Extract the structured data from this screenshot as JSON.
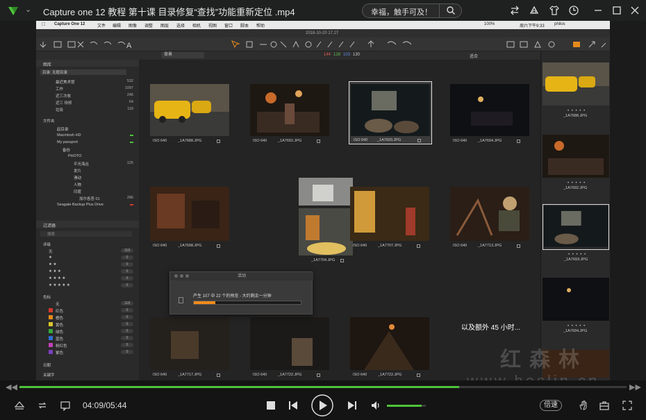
{
  "player": {
    "title": "Capture one 12 教程 第十课 目录修复“查找”功能重新定位 .mp4",
    "search_text": "幸福，触手可及！",
    "time": "04:09/05:44",
    "progress": 0.724,
    "volume": 0.9,
    "speed_label": "倍速",
    "subtitle": "以及额外 45 小时...",
    "watermark_cn": "红森林",
    "watermark_url": "www.hoslin.cn",
    "accent": "#4fc33c"
  },
  "capture_one": {
    "menubar": {
      "app": "Capture One 12",
      "items": [
        "文件",
        "编辑",
        "图像",
        "调整",
        "图层",
        "选择",
        "相机",
        "视图",
        "窗口",
        "脚本",
        "帮助"
      ],
      "status": "100%",
      "clock": "周六下午9:33",
      "user": "philos"
    },
    "window_date": "2018-10-20 17.27",
    "toolbar2": {
      "view_select": "背景",
      "counts": [
        "144",
        "128",
        "103",
        "130"
      ],
      "fit_label": "适合"
    },
    "library": {
      "header": "图库",
      "select": "目录: 无题目录",
      "collections": [
        {
          "label": "最近美术馆",
          "count": "532"
        },
        {
          "label": "工作",
          "count": "1097"
        },
        {
          "label": "近三次收",
          "count": "246"
        },
        {
          "label": "近三 待修",
          "count": "64"
        },
        {
          "label": "垃圾",
          "count": "118"
        }
      ],
      "folders_header": "文件夹",
      "folders": [
        {
          "label": "起目录",
          "indent": 18
        },
        {
          "label": "Macintosh HD",
          "indent": 18
        },
        {
          "label": "My passport",
          "indent": 18
        },
        {
          "label": "备份",
          "indent": 26
        },
        {
          "label": "PHOTO",
          "indent": 34
        },
        {
          "label": "平光海丛",
          "indent": 42,
          "count": "125"
        },
        {
          "label": "发片",
          "indent": 42
        },
        {
          "label": "滑动",
          "indent": 42
        },
        {
          "label": "人物",
          "indent": 42
        },
        {
          "label": "印度",
          "indent": 42
        },
        {
          "label": "加尔各答 01",
          "indent": 50,
          "count": "286"
        },
        {
          "label": "Seagate Backup Plus Drive",
          "indent": 18
        }
      ]
    },
    "filter": {
      "header": "过滤器",
      "search_placeholder": "搜索",
      "rating_header": "评级",
      "ratings": [
        {
          "label": "无",
          "count": "118"
        },
        {
          "label": "★",
          "count": "0"
        },
        {
          "label": "★ ★",
          "count": "0"
        },
        {
          "label": "★ ★ ★",
          "count": "0"
        },
        {
          "label": "★ ★ ★ ★",
          "count": "0"
        },
        {
          "label": "★ ★ ★ ★ ★",
          "count": "0"
        }
      ],
      "color_header": "色标",
      "colors": [
        {
          "label": "无",
          "count": "118",
          "color": ""
        },
        {
          "label": "红色",
          "count": "0",
          "color": "#d33a2c"
        },
        {
          "label": "橙色",
          "count": "0",
          "color": "#e58a1c"
        },
        {
          "label": "黄色",
          "count": "0",
          "color": "#d9c72a"
        },
        {
          "label": "绿色",
          "count": "0",
          "color": "#36a83a"
        },
        {
          "label": "蓝色",
          "count": "0",
          "color": "#2f6fd1"
        },
        {
          "label": "粉红色",
          "count": "0",
          "color": "#c240b8"
        },
        {
          "label": "紫色",
          "count": "0",
          "color": "#7a3fbf"
        }
      ],
      "date_header": "日期",
      "more_header": "关键字"
    },
    "thumbs": [
      {
        "iso": "ISO 640",
        "name": "_1A7688.JPG"
      },
      {
        "iso": "ISO 640",
        "name": "_1A7692.JPG"
      },
      {
        "iso": "ISO 640",
        "name": "_1A7693.JPG"
      },
      {
        "iso": "ISO 640",
        "name": "_1A7694.JPG"
      },
      {
        "iso": "ISO 640",
        "name": "_1A7698.JPG"
      },
      {
        "iso": "",
        "name": "_1A7704.JPG"
      },
      {
        "iso": "ISO 640",
        "name": "_1A7707.JPG"
      },
      {
        "iso": "ISO 640",
        "name": "_1A7713.JPG"
      },
      {
        "iso": "ISO 640",
        "name": "_1A7717.JPG"
      },
      {
        "iso": "ISO 640",
        "name": "_1A7722.JPG"
      },
      {
        "iso": "ISO 640",
        "name": "_1A7722.JPG"
      }
    ],
    "filmstrip": [
      {
        "name": "_1A7688.JPG"
      },
      {
        "name": "_1A7692.JPG"
      },
      {
        "name": "_1A7693.JPG"
      },
      {
        "name": "_1A7694.JPG"
      }
    ],
    "dialog": {
      "title": "活动",
      "message": "产生 107 中 22 个的预览 - 大约剩余一分钟",
      "progress": 0.2
    }
  }
}
